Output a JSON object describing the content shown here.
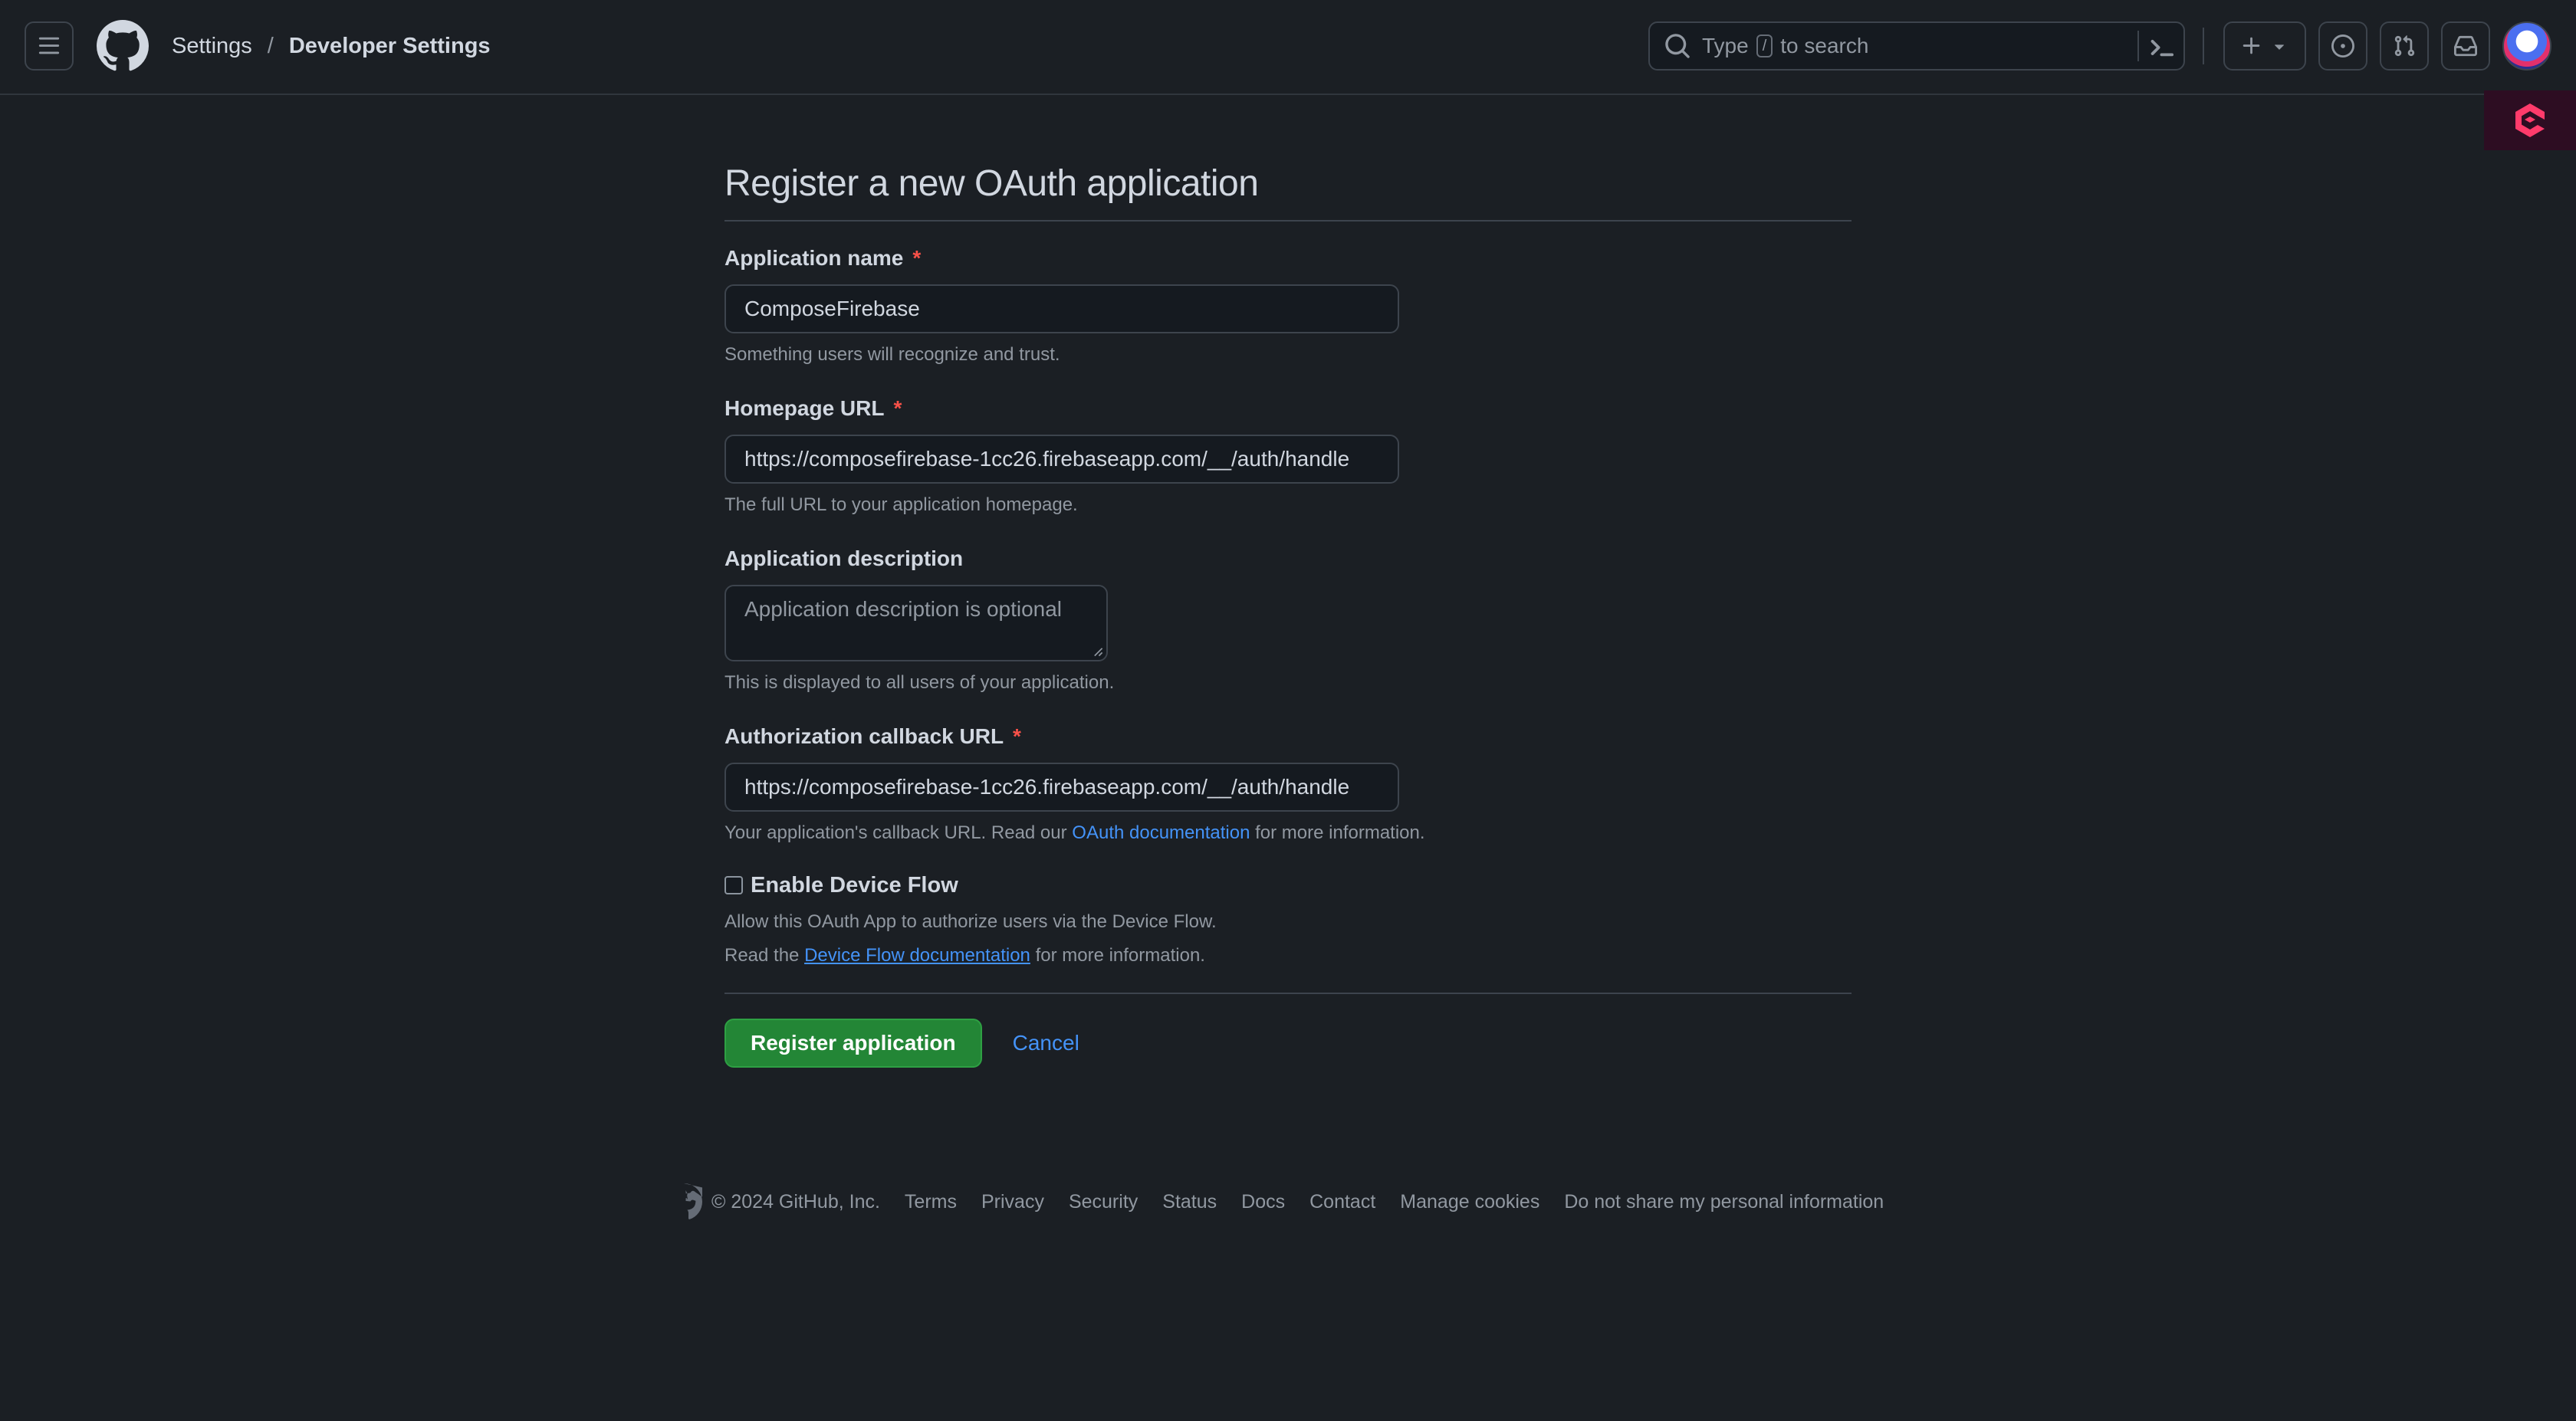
{
  "header": {
    "breadcrumbs": [
      "Settings",
      "Developer Settings"
    ],
    "breadcrumb_separator": "/",
    "search": {
      "prefix": "Type",
      "key": "/",
      "suffix": "to search"
    }
  },
  "form": {
    "title": "Register a new OAuth application",
    "app_name": {
      "label": "Application name",
      "required_mark": "*",
      "value": "ComposeFirebase",
      "hint": "Something users will recognize and trust."
    },
    "homepage_url": {
      "label": "Homepage URL",
      "required_mark": "*",
      "value": "https://composefirebase-1cc26.firebaseapp.com/__/auth/handle",
      "hint": "The full URL to your application homepage."
    },
    "description": {
      "label": "Application description",
      "placeholder": "Application description is optional",
      "hint": "This is displayed to all users of your application."
    },
    "callback_url": {
      "label": "Authorization callback URL",
      "required_mark": "*",
      "value": "https://composefirebase-1cc26.firebaseapp.com/__/auth/handle",
      "hint_prefix": "Your application's callback URL. Read our",
      "hint_link": "OAuth documentation",
      "hint_suffix": "for more information."
    },
    "device_flow": {
      "label": "Enable Device Flow",
      "checked": false,
      "hint1": "Allow this OAuth App to authorize users via the Device Flow.",
      "hint2_prefix": "Read the",
      "hint2_link": "Device Flow documentation",
      "hint2_suffix": "for more information."
    },
    "submit_label": "Register application",
    "cancel_label": "Cancel"
  },
  "footer": {
    "copyright": "© 2024 GitHub, Inc.",
    "links": [
      "Terms",
      "Privacy",
      "Security",
      "Status",
      "Docs",
      "Contact",
      "Manage cookies",
      "Do not share my personal information"
    ]
  },
  "colors": {
    "background": "#1b1f24",
    "link": "#4493f8",
    "primary_button": "#238636",
    "required": "#f85149"
  }
}
